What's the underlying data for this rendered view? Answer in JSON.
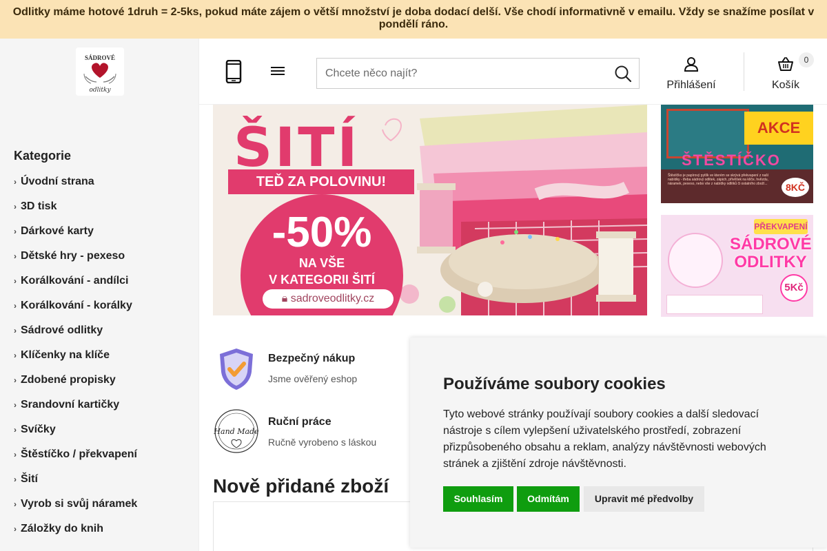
{
  "announcement": "Odlitky máme hotové 1druh = 2-5ks, pokud máte zájem o větší množství je doba dodací delší. Vše chodí informativně v emailu. Vždy se snažíme posílat v pondělí ráno.",
  "logo": {
    "text_top": "SÁDROVÉ",
    "text_bottom": "odlitky",
    "heart_color": "#b3142b"
  },
  "sidebar": {
    "title": "Kategorie",
    "items": [
      {
        "label": "Úvodní strana"
      },
      {
        "label": "3D tisk"
      },
      {
        "label": "Dárkové karty"
      },
      {
        "label": "Dětské hry - pexeso"
      },
      {
        "label": "Korálkování - andílci"
      },
      {
        "label": "Korálkování - korálky"
      },
      {
        "label": "Sádrové odlitky"
      },
      {
        "label": "Klíčenky na klíče"
      },
      {
        "label": "Zdobené propisky"
      },
      {
        "label": "Srandovní kartičky"
      },
      {
        "label": "Svíčky"
      },
      {
        "label": "Štěstíčko / překvapení"
      },
      {
        "label": "Šití"
      },
      {
        "label": "Vyrob si svůj náramek"
      },
      {
        "label": "Záložky do knih"
      }
    ]
  },
  "header": {
    "search_placeholder": "Chcete něco najít?",
    "login_label": "Přihlášení",
    "cart_label": "Košík",
    "cart_count": "0",
    "icons": [
      "phone-icon",
      "menu-icon",
      "search-icon",
      "user-icon",
      "basket-icon"
    ]
  },
  "banner_main": {
    "title": "ŠITÍ",
    "ribbon": "TEĎ ZA POLOVINU!",
    "discount": "-50%",
    "line1": "NA VŠE",
    "line2": "V KATEGORII ŠITÍ",
    "url": "sadroveodlitky.cz",
    "brand_color": "#e13b6d"
  },
  "banner_top": {
    "badge": "AKCE",
    "title": "ŠTĚSTÍČKO",
    "small_text": "Štěstíčko je papírový pytlík ve kterém se skrývá překvapení z naší nabídky - třeba sádrový odlitek, zápich, přívěšek na klíče, hvězdu, náramek, pexeso, nebo vše z nabídky odlitků či ostatního zboží...",
    "price": "8KČ"
  },
  "banner_bottom": {
    "tag": "PŘEKVAPENÍ",
    "title_line1": "SÁDROVÉ",
    "title_line2": "ODLITKY",
    "price": "5Kč"
  },
  "features": [
    {
      "title": "Bezpečný nákup",
      "subtitle": "Jsme ověřený eshop",
      "icon": "shield-check-icon"
    },
    {
      "title": "Ruční práce",
      "subtitle": "Ručně vyrobeno s láskou",
      "icon": "handmade-icon",
      "badge_text": "Hand Made"
    }
  ],
  "new_products_title": "Nově přidané zboží",
  "cookie": {
    "title": "Používáme soubory cookies",
    "text": "Tyto webové stránky používají soubory cookies a další sledovací nástroje s cílem vylepšení uživatelského prostředí, zobrazení přizpůsobeného obsahu a reklam, analýzy návštěvnosti webových stránek a zjištění zdroje návštěvnosti.",
    "accept": "Souhlasím",
    "reject": "Odmítám",
    "settings": "Upravit mé předvolby"
  },
  "colors": {
    "announcement_bg": "#fbe3b5",
    "sidebar_bg": "#f5f5f5",
    "cookie_button": "#0f9d0f",
    "cookie_bg": "#f5f5f5"
  }
}
